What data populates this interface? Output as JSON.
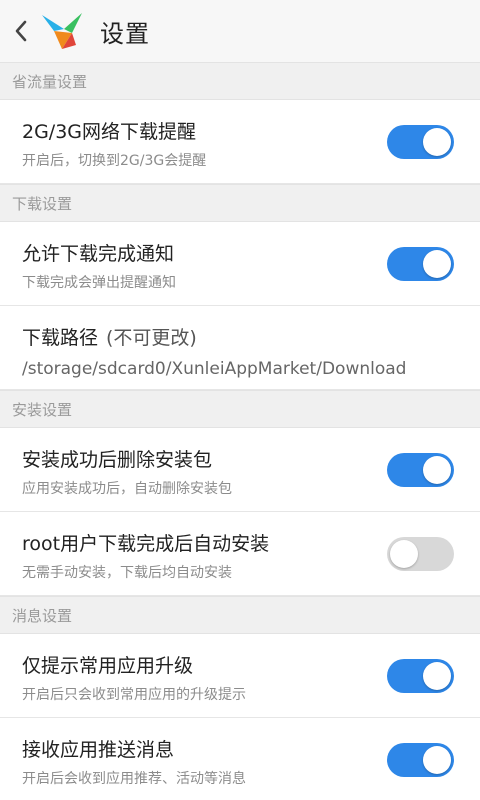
{
  "header": {
    "title": "设置"
  },
  "sections": [
    {
      "title": "省流量设置"
    },
    {
      "title": "下载设置"
    },
    {
      "title": "安装设置"
    },
    {
      "title": "消息设置"
    }
  ],
  "items": [
    {
      "title": "2G/3G网络下载提醒",
      "subtitle": "开启后，切换到2G/3G会提醒",
      "enabled": true
    },
    {
      "title": "允许下载完成通知",
      "subtitle": "下载完成会弹出提醒通知",
      "enabled": true
    },
    {
      "title": "下载路径",
      "note": "(不可更改)",
      "subtitle": "/storage/sdcard0/XunleiAppMarket/Download"
    },
    {
      "title": "安装成功后删除安装包",
      "subtitle": "应用安装成功后，自动删除安装包",
      "enabled": true
    },
    {
      "title": "root用户下载完成后自动安装",
      "subtitle": "无需手动安装，下载后均自动安装",
      "enabled": false
    },
    {
      "title": "仅提示常用应用升级",
      "subtitle": "开启后只会收到常用应用的升级提示",
      "enabled": true
    },
    {
      "title": "接收应用推送消息",
      "subtitle": "开启后会收到应用推荐、活动等消息",
      "enabled": true
    }
  ],
  "colors": {
    "accent": "#2e87e8",
    "toggle_off": "#d8d8d8",
    "background": "#f7f7f7"
  }
}
